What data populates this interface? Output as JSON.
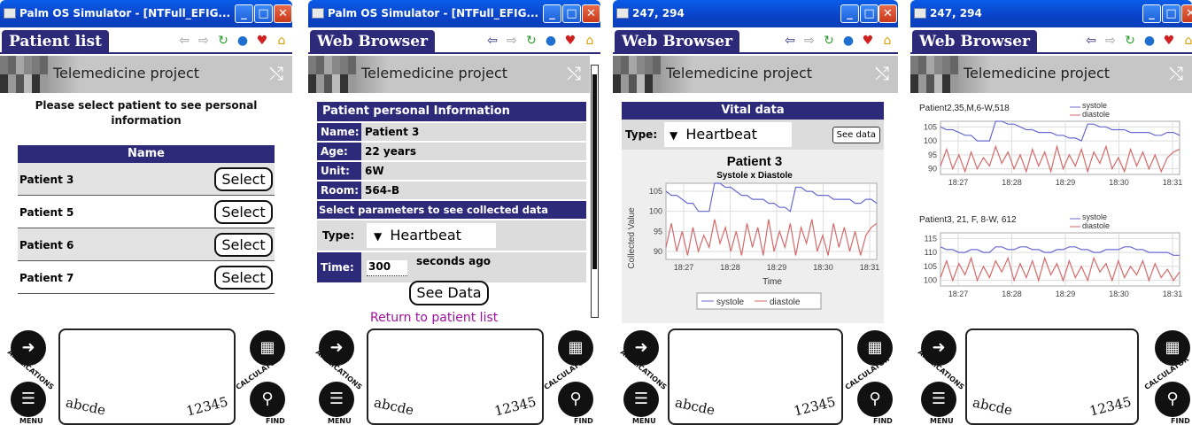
{
  "panels": [
    {
      "title": "Palm OS Simulator - [NTFull_EFIG...",
      "app_name": "Patient list"
    },
    {
      "title": "Palm OS Simulator - [NTFull_EFIG...",
      "app_name": "Web Browser"
    },
    {
      "title": "247, 294",
      "app_name": "Web Browser"
    },
    {
      "title": "247, 294",
      "app_name": "Web Browser"
    }
  ],
  "banner_text": "Telemedicine project",
  "graffiti": {
    "abc": "abcde",
    "num": "12345",
    "applications": "APPLICATIONS",
    "menu": "MENU",
    "calculator": "CALCULATOR",
    "find": "FIND"
  },
  "patient_list": {
    "instruction": "Please select patient to see personal information",
    "column_header": "Name",
    "rows": [
      "Patient 3",
      "Patient 5",
      "Patient 6",
      "Patient 7"
    ],
    "select_label": "Select"
  },
  "personal_info": {
    "heading": "Patient personal Information",
    "fields": [
      {
        "label": "Name:",
        "value": "Patient 3"
      },
      {
        "label": "Age:",
        "value": "22 years"
      },
      {
        "label": "Unit:",
        "value": "6W"
      },
      {
        "label": "Room:",
        "value": "564-B"
      }
    ],
    "select_params": "Select parameters to see collected data",
    "type_label": "Type:",
    "type_value": "Heartbeat",
    "time_label": "Time:",
    "time_value": "300",
    "time_suffix": "seconds ago",
    "see_data": "See Data",
    "return_link": "Return to patient list"
  },
  "vital": {
    "heading": "Vital data",
    "type_label": "Type:",
    "type_value": "Heartbeat",
    "see_data": "See data"
  },
  "chart_data": [
    {
      "type": "line",
      "title": "Patient 3",
      "subtitle": "Systole x Diastole",
      "xlabel": "Time",
      "ylabel": "Collected Value",
      "x": [
        "18:27",
        "18:28",
        "18:29",
        "18:30",
        "18:31"
      ],
      "ylim": [
        88,
        107
      ],
      "yticks": [
        90,
        95,
        100,
        105
      ],
      "legend": "bottom",
      "series": [
        {
          "name": "systole",
          "color": "#6a6ad0",
          "values": [
            105,
            104,
            104,
            103,
            102,
            102,
            100,
            100,
            100,
            107,
            107,
            106,
            106,
            105,
            104,
            104,
            103,
            103,
            103,
            102,
            102,
            101,
            101,
            100,
            106,
            106,
            105,
            105,
            104,
            104,
            104,
            103,
            103,
            103,
            103,
            102,
            102,
            103,
            103,
            102
          ]
        },
        {
          "name": "diastole",
          "color": "#d46a6a",
          "values": [
            91,
            97,
            90,
            95,
            89,
            96,
            90,
            94,
            91,
            98,
            92,
            96,
            90,
            95,
            89,
            97,
            91,
            96,
            89,
            98,
            90,
            95,
            91,
            97,
            89,
            96,
            92,
            98,
            90,
            94,
            89,
            97,
            91,
            96,
            90,
            95,
            89,
            94,
            96,
            97
          ]
        }
      ]
    },
    {
      "type": "line",
      "title": "Patient2,35,M,6-W,518",
      "x": [
        "18:27",
        "18:28",
        "18:29",
        "18:30",
        "18:31"
      ],
      "ylim": [
        88,
        107
      ],
      "yticks": [
        90,
        95,
        100,
        105
      ],
      "legend": "top-right",
      "series": [
        {
          "name": "systole",
          "color": "#6a6ad0",
          "values": [
            105,
            104,
            104,
            103,
            102,
            102,
            100,
            100,
            100,
            107,
            107,
            106,
            106,
            105,
            104,
            104,
            103,
            103,
            103,
            102,
            102,
            101,
            101,
            100,
            106,
            106,
            105,
            105,
            104,
            104,
            104,
            103,
            103,
            103,
            103,
            102,
            102,
            103,
            103,
            102
          ]
        },
        {
          "name": "diastole",
          "color": "#d46a6a",
          "values": [
            91,
            97,
            90,
            95,
            89,
            96,
            90,
            94,
            91,
            98,
            92,
            96,
            90,
            95,
            89,
            97,
            91,
            96,
            89,
            98,
            90,
            95,
            91,
            97,
            89,
            96,
            92,
            98,
            90,
            94,
            89,
            97,
            91,
            96,
            90,
            95,
            89,
            94,
            96,
            97
          ]
        }
      ]
    },
    {
      "type": "line",
      "title": "Patient3, 21, F, 8-W, 612",
      "x": [
        "18:27",
        "18:28",
        "18:29",
        "18:30",
        "18:31"
      ],
      "ylim": [
        98,
        117
      ],
      "yticks": [
        100,
        105,
        110,
        115
      ],
      "legend": "top-right",
      "series": [
        {
          "name": "systole",
          "color": "#6a6ad0",
          "values": [
            112,
            111,
            111,
            110,
            110,
            111,
            111,
            110,
            110,
            112,
            112,
            111,
            111,
            112,
            112,
            111,
            111,
            110,
            110,
            111,
            111,
            112,
            112,
            111,
            111,
            110,
            110,
            111,
            111,
            111,
            112,
            112,
            111,
            111,
            110,
            110,
            110,
            110,
            109,
            109
          ]
        },
        {
          "name": "diastole",
          "color": "#d46a6a",
          "values": [
            101,
            107,
            100,
            106,
            102,
            108,
            100,
            105,
            101,
            107,
            103,
            108,
            100,
            106,
            101,
            107,
            100,
            108,
            102,
            106,
            100,
            107,
            101,
            105,
            100,
            108,
            103,
            106,
            100,
            107,
            101,
            105,
            102,
            107,
            100,
            106,
            101,
            104,
            100,
            103
          ]
        }
      ]
    }
  ]
}
